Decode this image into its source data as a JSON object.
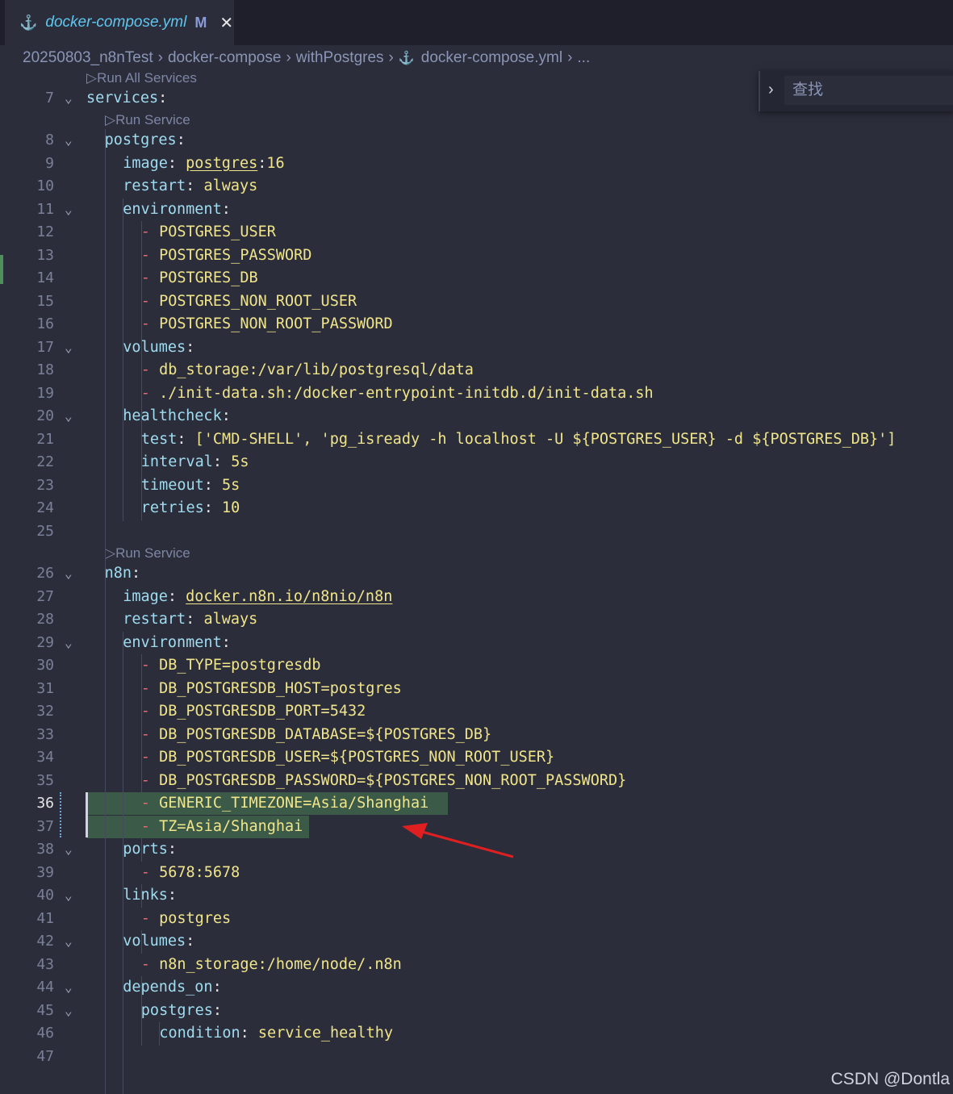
{
  "tab": {
    "icon": "docker-whale-icon",
    "filename": "docker-compose.yml",
    "modified": "M",
    "close": "✕"
  },
  "breadcrumb": {
    "items": [
      "20250803_n8nTest",
      "docker-compose",
      "withPostgres",
      "docker-compose.yml",
      "..."
    ]
  },
  "find": {
    "placeholder": "查找",
    "toggle": "›"
  },
  "codelens": {
    "run_all": "▷Run All Services",
    "run_service_1": "▷Run Service",
    "run_service_2": "▷Run Service"
  },
  "lines": [
    {
      "num": "7",
      "text": "services:"
    },
    {
      "num": "8",
      "text": "postgres:"
    },
    {
      "num": "9",
      "text": "image: postgres:16"
    },
    {
      "num": "10",
      "text": "restart: always"
    },
    {
      "num": "11",
      "text": "environment:"
    },
    {
      "num": "12",
      "text": "- POSTGRES_USER"
    },
    {
      "num": "13",
      "text": "- POSTGRES_PASSWORD"
    },
    {
      "num": "14",
      "text": "- POSTGRES_DB"
    },
    {
      "num": "15",
      "text": "- POSTGRES_NON_ROOT_USER"
    },
    {
      "num": "16",
      "text": "- POSTGRES_NON_ROOT_PASSWORD"
    },
    {
      "num": "17",
      "text": "volumes:"
    },
    {
      "num": "18",
      "text": "- db_storage:/var/lib/postgresql/data"
    },
    {
      "num": "19",
      "text": "- ./init-data.sh:/docker-entrypoint-initdb.d/init-data.sh"
    },
    {
      "num": "20",
      "text": "healthcheck:"
    },
    {
      "num": "21",
      "text": "test: ['CMD-SHELL', 'pg_isready -h localhost -U ${POSTGRES_USER} -d ${POSTGRES_DB}']"
    },
    {
      "num": "22",
      "text": "interval: 5s"
    },
    {
      "num": "23",
      "text": "timeout: 5s"
    },
    {
      "num": "24",
      "text": "retries: 10"
    },
    {
      "num": "25",
      "text": ""
    },
    {
      "num": "26",
      "text": "n8n:"
    },
    {
      "num": "27",
      "text": "image: docker.n8n.io/n8nio/n8n"
    },
    {
      "num": "28",
      "text": "restart: always"
    },
    {
      "num": "29",
      "text": "environment:"
    },
    {
      "num": "30",
      "text": "- DB_TYPE=postgresdb"
    },
    {
      "num": "31",
      "text": "- DB_POSTGRESDB_HOST=postgres"
    },
    {
      "num": "32",
      "text": "- DB_POSTGRESDB_PORT=5432"
    },
    {
      "num": "33",
      "text": "- DB_POSTGRESDB_DATABASE=${POSTGRES_DB}"
    },
    {
      "num": "34",
      "text": "- DB_POSTGRESDB_USER=${POSTGRES_NON_ROOT_USER}"
    },
    {
      "num": "35",
      "text": "- DB_POSTGRESDB_PASSWORD=${POSTGRES_NON_ROOT_PASSWORD}"
    },
    {
      "num": "36",
      "text": "- GENERIC_TIMEZONE=Asia/Shanghai"
    },
    {
      "num": "37",
      "text": "- TZ=Asia/Shanghai"
    },
    {
      "num": "38",
      "text": "ports:"
    },
    {
      "num": "39",
      "text": "- 5678:5678"
    },
    {
      "num": "40",
      "text": "links:"
    },
    {
      "num": "41",
      "text": "- postgres"
    },
    {
      "num": "42",
      "text": "volumes:"
    },
    {
      "num": "43",
      "text": "- n8n_storage:/home/node/.n8n"
    },
    {
      "num": "44",
      "text": "depends_on:"
    },
    {
      "num": "45",
      "text": "postgres:"
    },
    {
      "num": "46",
      "text": "condition: service_healthy"
    },
    {
      "num": "47",
      "text": ""
    }
  ],
  "watermark": "CSDN @Dontla",
  "colors": {
    "background": "#2b2d3a",
    "key": "#9fdcf0",
    "value": "#f0e58a",
    "dash": "#e06c75",
    "highlight": "#3c5a48",
    "arrow": "#e02020"
  }
}
